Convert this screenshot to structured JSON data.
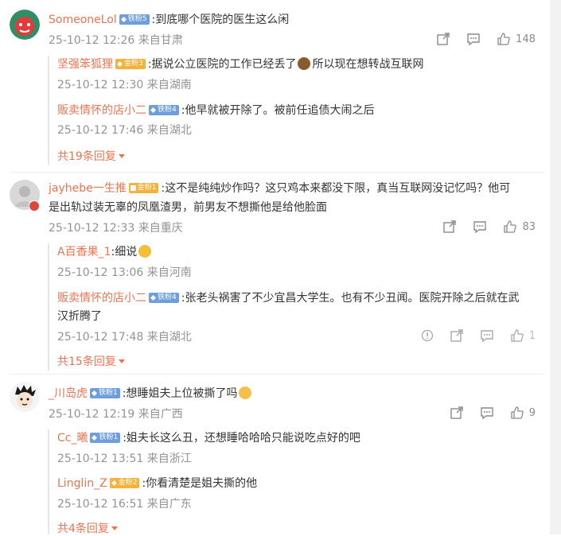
{
  "comments": [
    {
      "user": "SomeoneLol",
      "badge": "铁粉5",
      "text": ":到底哪个医院的医生这么闲",
      "time": "25-10-12 12:26",
      "location": "来自甘肃",
      "likes": "148",
      "replies": [
        {
          "user": "坚强笨狐狸",
          "badge": "金粉3",
          "text1": ":据说公立医院的工作已经丢了",
          "emoji": "monkey-emoji",
          "text2": "所以现在想转战互联网",
          "time": "25-10-12 12:30",
          "location": "来自湖南"
        },
        {
          "user": "贩卖情怀的店小二",
          "badge": "铁粉4",
          "text": ":他早就被开除了。被前任追债大闹之后",
          "time": "25-10-12 17:46",
          "location": "来自湖北"
        }
      ],
      "more": "共19条回复"
    },
    {
      "user": "jayhebe一生推",
      "badge": "金粉1",
      "text_line1": ":这不是纯纯炒作吗？这只鸡本来都没下限，真当互联网没记忆吗？他可",
      "text_line2": "是出轨过装无辜的凤凰渣男，前男友不想撕他是给他脸面",
      "time": "25-10-12 12:33",
      "location": "来自重庆",
      "likes": "83",
      "replies": [
        {
          "user": "A百香果_1",
          "text": ":细说",
          "emoji": "clap-emoji",
          "time": "25-10-12 13:06",
          "location": "来自河南"
        },
        {
          "user": "贩卖情怀的店小二",
          "badge": "铁粉4",
          "text_line1": ":张老头祸害了不少宜昌大学生。也有不少丑闻。医院开除之后就在武",
          "text_line2": "汉折腾了",
          "time": "25-10-12 17:48",
          "location": "来自湖北",
          "likes": "1"
        }
      ],
      "more": "共15条回复"
    },
    {
      "user": "_川岛虎",
      "badge": "铁粉1",
      "text": ":想睡姐夫上位被撕了吗",
      "emoji": "crying-emoji",
      "time": "25-10-12 12:19",
      "location": "来自广西",
      "likes": "9",
      "replies": [
        {
          "user": "Cc_曦",
          "badge": "铁粉1",
          "text": ":姐夫长这么丑，还想睡哈哈哈只能说吃点好的吧",
          "time": "25-10-12 13:51",
          "location": "来自浙江"
        },
        {
          "user": "Linglin_Z",
          "badge": "金粉2",
          "text": ":你看清楚是姐夫撕的他",
          "time": "25-10-12 16:51",
          "location": "来自广东"
        }
      ],
      "more": "共4条回复"
    }
  ],
  "colors": {
    "username": "#eb7350",
    "meta": "#939393",
    "iron_badge": "#6e9fdc",
    "gold_badge": "#f5b13a"
  }
}
